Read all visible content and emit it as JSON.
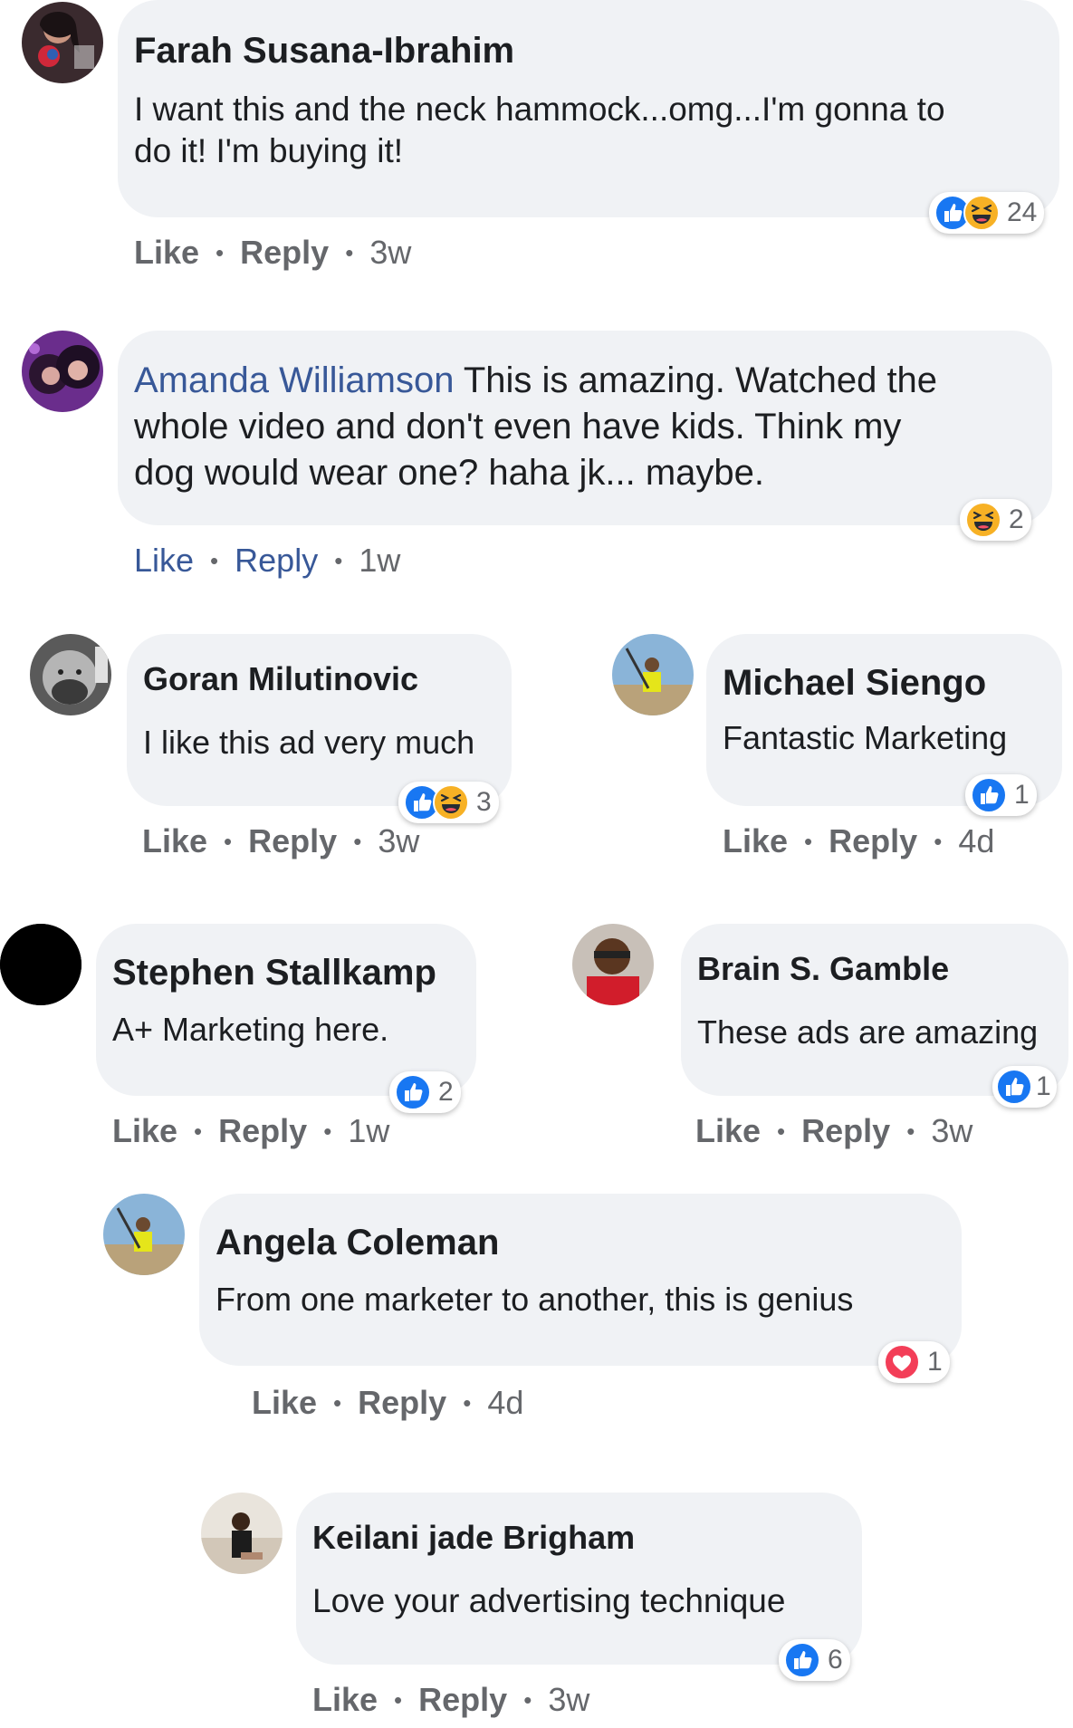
{
  "colors": {
    "bubble_bg": "#f0f2f5",
    "link_blue": "#385898",
    "like_blue": "#1877f2",
    "meta_gray": "#65676b",
    "heart_red": "#f33e58",
    "haha_yellow": "#f7b125"
  },
  "action_labels": {
    "like": "Like",
    "reply": "Reply",
    "separator": "•"
  },
  "comments": [
    {
      "name": "Farah Susana-Ibrahim",
      "text_line1": "I want this and the neck hammock...omg...I'm gonna to",
      "text_line2": "do it! I'm buying it!",
      "reactions": [
        "like-icon",
        "haha-icon"
      ],
      "reaction_count": "24",
      "time": "3w"
    },
    {
      "name": "Amanda Williamson",
      "text_line1": "This is amazing. Watched the",
      "text_line2": "whole video and don't even have kids. Think my",
      "text_line3": "dog would wear one? haha jk... maybe.",
      "reactions": [
        "haha-icon"
      ],
      "reaction_count": "2",
      "time": "1w"
    },
    {
      "name": "Goran Milutinovic",
      "text": "I like this ad very much",
      "reactions": [
        "like-icon",
        "haha-icon"
      ],
      "reaction_count": "3",
      "time": "3w"
    },
    {
      "name": "Michael Siengo",
      "text": "Fantastic Marketing",
      "reactions": [
        "like-icon"
      ],
      "reaction_count": "1",
      "time": "4d"
    },
    {
      "name": "Stephen Stallkamp",
      "text": "A+ Marketing here.",
      "reactions": [
        "like-icon"
      ],
      "reaction_count": "2",
      "time": "1w"
    },
    {
      "name": "Brain S. Gamble",
      "text": "These ads are amazing",
      "reactions": [
        "like-icon"
      ],
      "reaction_count": "1",
      "time": "3w"
    },
    {
      "name": "Angela Coleman",
      "text": "From one marketer to another, this is genius",
      "reactions": [
        "love-icon"
      ],
      "reaction_count": "1",
      "time": "4d"
    },
    {
      "name": "Keilani jade Brigham",
      "text": "Love your advertising technique",
      "reactions": [
        "like-icon"
      ],
      "reaction_count": "6",
      "time": "3w"
    }
  ]
}
